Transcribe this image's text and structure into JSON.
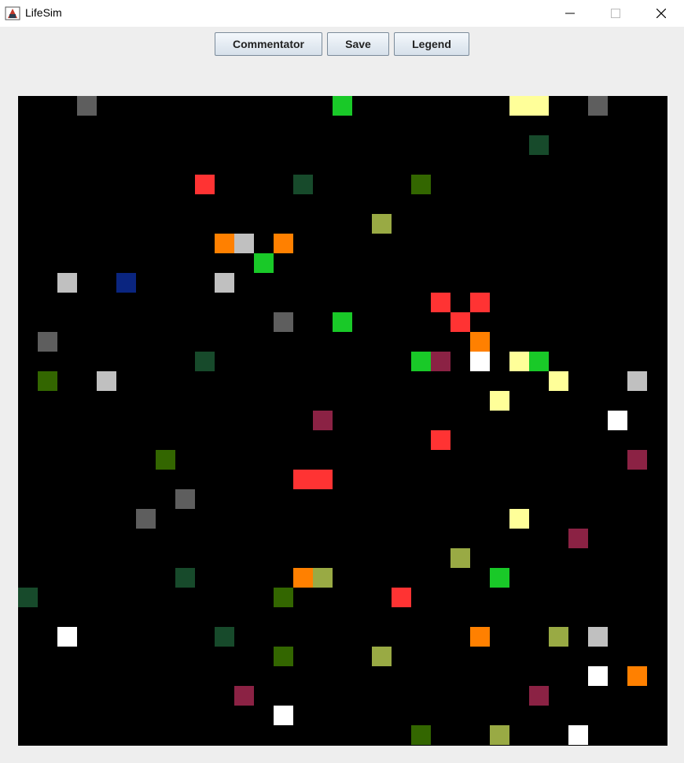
{
  "window": {
    "title": "LifeSim"
  },
  "toolbar": {
    "commentator_label": "Commentator",
    "save_label": "Save",
    "legend_label": "Legend"
  },
  "grid": {
    "columns": 33,
    "rows": 33,
    "background": "#000000",
    "cells": [
      {
        "col": 3,
        "row": 0,
        "color": "#5e5e5e"
      },
      {
        "col": 16,
        "row": 0,
        "color": "#19c928"
      },
      {
        "col": 25,
        "row": 0,
        "color": "#ffff99"
      },
      {
        "col": 26,
        "row": 0,
        "color": "#ffff99"
      },
      {
        "col": 29,
        "row": 0,
        "color": "#5e5e5e"
      },
      {
        "col": 26,
        "row": 2,
        "color": "#174a2b"
      },
      {
        "col": 9,
        "row": 4,
        "color": "#ff3333"
      },
      {
        "col": 14,
        "row": 4,
        "color": "#174a2b"
      },
      {
        "col": 20,
        "row": 4,
        "color": "#336600"
      },
      {
        "col": 18,
        "row": 6,
        "color": "#99aa44"
      },
      {
        "col": 10,
        "row": 7,
        "color": "#ff8000"
      },
      {
        "col": 11,
        "row": 7,
        "color": "#c0c0c0"
      },
      {
        "col": 13,
        "row": 7,
        "color": "#ff8000"
      },
      {
        "col": 12,
        "row": 8,
        "color": "#19c928"
      },
      {
        "col": 2,
        "row": 9,
        "color": "#c0c0c0"
      },
      {
        "col": 5,
        "row": 9,
        "color": "#0a2580"
      },
      {
        "col": 10,
        "row": 9,
        "color": "#c0c0c0"
      },
      {
        "col": 21,
        "row": 10,
        "color": "#ff3333"
      },
      {
        "col": 23,
        "row": 10,
        "color": "#ff3333"
      },
      {
        "col": 13,
        "row": 11,
        "color": "#5e5e5e"
      },
      {
        "col": 16,
        "row": 11,
        "color": "#19c928"
      },
      {
        "col": 22,
        "row": 11,
        "color": "#ff3333"
      },
      {
        "col": 1,
        "row": 12,
        "color": "#5e5e5e"
      },
      {
        "col": 23,
        "row": 12,
        "color": "#ff8000"
      },
      {
        "col": 9,
        "row": 13,
        "color": "#174a2b"
      },
      {
        "col": 20,
        "row": 13,
        "color": "#19c928"
      },
      {
        "col": 21,
        "row": 13,
        "color": "#8b2244"
      },
      {
        "col": 23,
        "row": 13,
        "color": "#ffffff"
      },
      {
        "col": 25,
        "row": 13,
        "color": "#ffff99"
      },
      {
        "col": 26,
        "row": 13,
        "color": "#19c928"
      },
      {
        "col": 1,
        "row": 14,
        "color": "#336600"
      },
      {
        "col": 4,
        "row": 14,
        "color": "#c0c0c0"
      },
      {
        "col": 27,
        "row": 14,
        "color": "#ffff99"
      },
      {
        "col": 31,
        "row": 14,
        "color": "#c0c0c0"
      },
      {
        "col": 24,
        "row": 15,
        "color": "#ffff99"
      },
      {
        "col": 15,
        "row": 16,
        "color": "#8b2244"
      },
      {
        "col": 30,
        "row": 16,
        "color": "#ffffff"
      },
      {
        "col": 21,
        "row": 17,
        "color": "#ff3333"
      },
      {
        "col": 7,
        "row": 18,
        "color": "#336600"
      },
      {
        "col": 31,
        "row": 18,
        "color": "#8b2244"
      },
      {
        "col": 14,
        "row": 19,
        "color": "#ff3333"
      },
      {
        "col": 15,
        "row": 19,
        "color": "#ff3333"
      },
      {
        "col": 8,
        "row": 20,
        "color": "#5e5e5e"
      },
      {
        "col": 6,
        "row": 21,
        "color": "#5e5e5e"
      },
      {
        "col": 25,
        "row": 21,
        "color": "#ffff99"
      },
      {
        "col": 28,
        "row": 22,
        "color": "#8b2244"
      },
      {
        "col": 22,
        "row": 23,
        "color": "#99aa44"
      },
      {
        "col": 8,
        "row": 24,
        "color": "#174a2b"
      },
      {
        "col": 14,
        "row": 24,
        "color": "#ff8000"
      },
      {
        "col": 15,
        "row": 24,
        "color": "#99aa44"
      },
      {
        "col": 24,
        "row": 24,
        "color": "#19c928"
      },
      {
        "col": 0,
        "row": 25,
        "color": "#174a2b"
      },
      {
        "col": 13,
        "row": 25,
        "color": "#336600"
      },
      {
        "col": 19,
        "row": 25,
        "color": "#ff3333"
      },
      {
        "col": 2,
        "row": 27,
        "color": "#ffffff"
      },
      {
        "col": 10,
        "row": 27,
        "color": "#174a2b"
      },
      {
        "col": 23,
        "row": 27,
        "color": "#ff8000"
      },
      {
        "col": 27,
        "row": 27,
        "color": "#99aa44"
      },
      {
        "col": 29,
        "row": 27,
        "color": "#c0c0c0"
      },
      {
        "col": 13,
        "row": 28,
        "color": "#336600"
      },
      {
        "col": 18,
        "row": 28,
        "color": "#99aa44"
      },
      {
        "col": 29,
        "row": 29,
        "color": "#ffffff"
      },
      {
        "col": 31,
        "row": 29,
        "color": "#ff8000"
      },
      {
        "col": 11,
        "row": 30,
        "color": "#8b2244"
      },
      {
        "col": 26,
        "row": 30,
        "color": "#8b2244"
      },
      {
        "col": 13,
        "row": 31,
        "color": "#ffffff"
      },
      {
        "col": 20,
        "row": 32,
        "color": "#336600"
      },
      {
        "col": 24,
        "row": 32,
        "color": "#99aa44"
      },
      {
        "col": 28,
        "row": 32,
        "color": "#ffffff"
      }
    ]
  }
}
